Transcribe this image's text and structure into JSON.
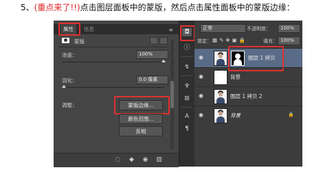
{
  "caption": {
    "prefix": "5、",
    "accent": "(重点来了!!)",
    "rest": "点击图层面板中的蒙版，然后点击属性面板中的蒙版边缘："
  },
  "colors": {
    "highlight": "#e23030",
    "selected_layer": "#596b87",
    "panel_bg": "#454545"
  },
  "properties": {
    "tabs": [
      "属性",
      "信息"
    ],
    "menu_icon": "menu-icon",
    "section_label": "蒙版",
    "density_label": "浓度：",
    "density_value": "100%",
    "feather_label": "羽化：",
    "feather_value": "0.0 像素",
    "adjust_label": "调整：",
    "buttons": [
      "蒙版边缘...",
      "颜色范围...",
      "反相"
    ]
  },
  "layers": {
    "blend_mode": "正常",
    "opacity_label": "不透明度：",
    "opacity_value": "100%",
    "lock_label": "锁定：",
    "fill_label": "填充：",
    "fill_value": "100%",
    "items": [
      {
        "name": "图层 1 拷贝",
        "selected": true
      },
      {
        "name": "背景"
      },
      {
        "name": "图层 1 拷贝 2"
      },
      {
        "name": "背景"
      }
    ]
  }
}
